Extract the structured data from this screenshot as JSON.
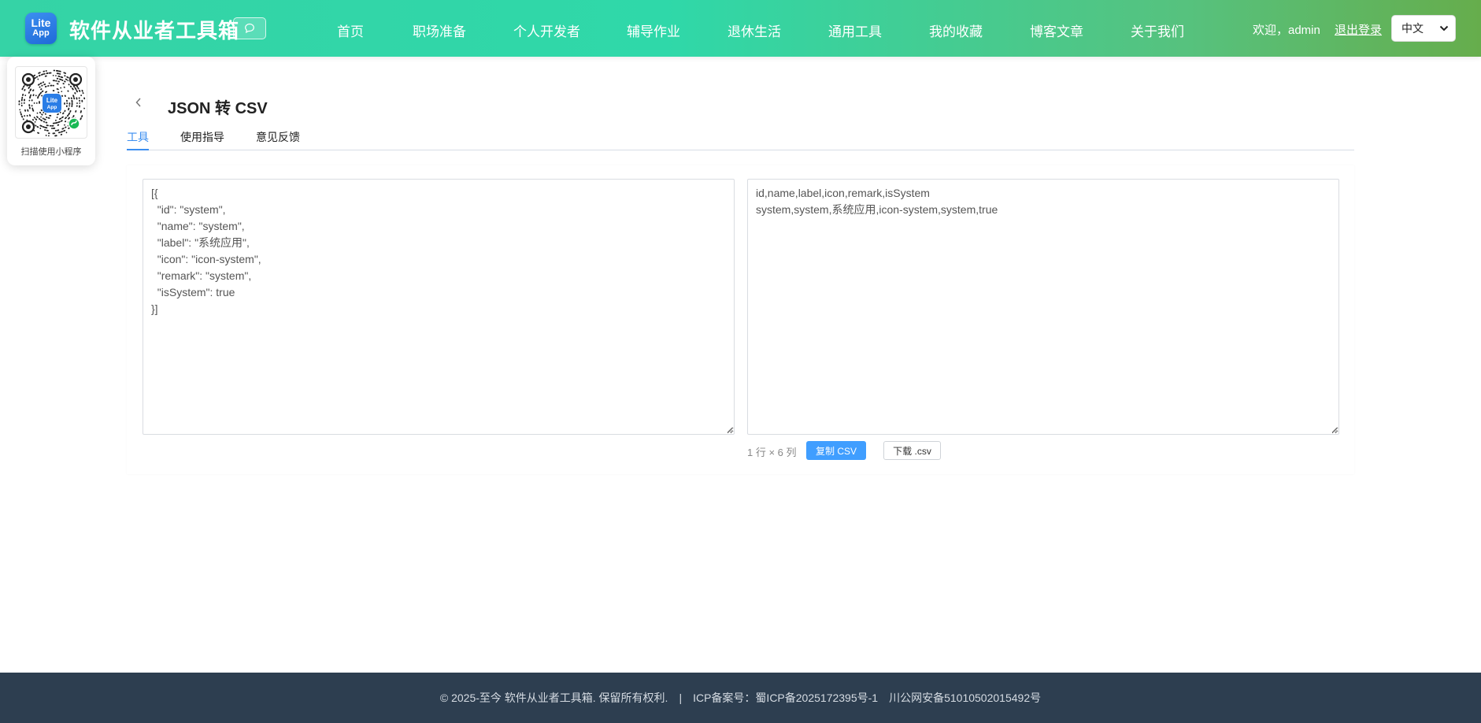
{
  "header": {
    "logo_top": "Lite",
    "logo_bottom": "App",
    "site_title": "软件从业者工具箱",
    "nav": [
      "首页",
      "职场准备",
      "个人开发者",
      "辅导作业",
      "退休生活",
      "通用工具",
      "我的收藏",
      "博客文章",
      "关于我们"
    ],
    "welcome": "欢迎，admin",
    "logout": "退出登录",
    "language": "中文"
  },
  "qr": {
    "label": "扫描使用小程序",
    "logo_top": "Lite",
    "logo_bottom": "App"
  },
  "page": {
    "title": "JSON 转 CSV",
    "tabs": [
      "工具",
      "使用指导",
      "意见反馈"
    ],
    "active_tab": "工具"
  },
  "editor": {
    "input": "[{\n  \"id\": \"system\",\n  \"name\": \"system\",\n  \"label\": \"系统应用\",\n  \"icon\": \"icon-system\",\n  \"remark\": \"system\",\n  \"isSystem\": true\n}]",
    "output": "id,name,label,icon,remark,isSystem\nsystem,system,系统应用,icon-system,system,true",
    "stats": "1 行 × 6 列",
    "copy_label": "复制 CSV",
    "download_label": "下载 .csv"
  },
  "footer": {
    "copyright": "© 2025-至今 软件从业者工具箱. 保留所有权利.",
    "separator": "|",
    "icp": "ICP备案号：蜀ICP备2025172395号-1",
    "police": "川公网安备51010502015492号"
  },
  "colors": {
    "header_gradient_start": "#35d3a6",
    "header_gradient_end": "#66ad4c",
    "accent": "#409eff",
    "footer_bg": "#2d3e50"
  },
  "icons": [
    "chat-bubble-icon",
    "chevron-left-icon",
    "chevron-down-icon",
    "mini-program-link-icon"
  ]
}
